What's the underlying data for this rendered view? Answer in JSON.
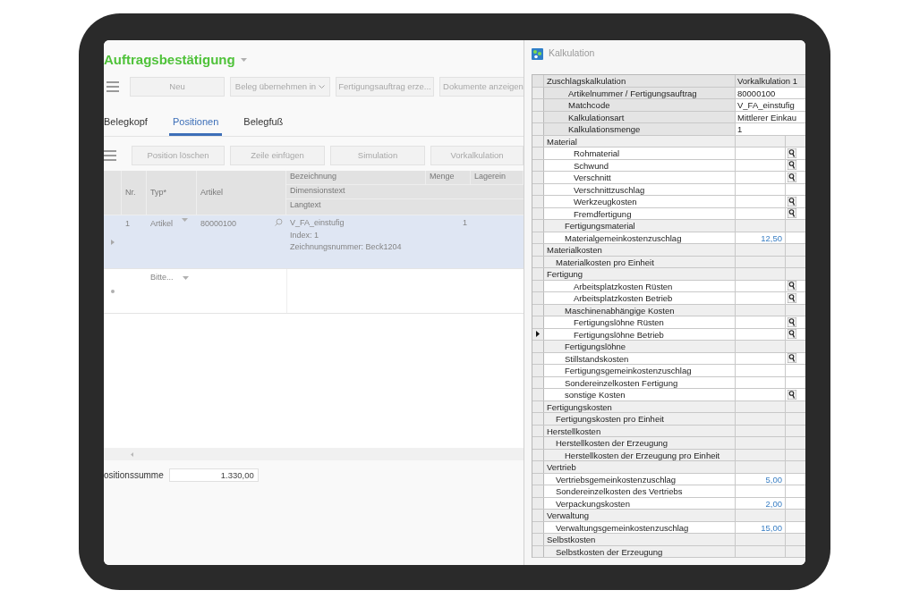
{
  "order": {
    "title": "Auftragsbestätigung",
    "toolbar": [
      {
        "label": "Neu",
        "kind": "button"
      },
      {
        "label": "Beleg übernehmen in",
        "kind": "dropdown"
      },
      {
        "label": "Fertigungsauftrag erze...",
        "kind": "button"
      },
      {
        "label": "Dokumente anzeigen",
        "kind": "button"
      }
    ],
    "tabs": [
      {
        "label": "Belegkopf",
        "selected": false
      },
      {
        "label": "Positionen",
        "selected": true
      },
      {
        "label": "Belegfuß",
        "selected": false
      }
    ],
    "grid_toolbar": [
      "Position löschen",
      "Zeile einfügen",
      "Simulation",
      "Vorkalkulation"
    ],
    "grid": {
      "columns": [
        "Nr.",
        "Typ*",
        "Artikel"
      ],
      "upper_columns": [
        "Bezeichnung",
        "Menge",
        "Lagerein"
      ],
      "dimension_column": "Dimensionstext",
      "longtext_column": "Langtext",
      "rows": [
        {
          "nr": "1",
          "type": "Artikel",
          "article": "80000100",
          "name": "V_FA_einstufig",
          "quantity": "1",
          "details": [
            "Index: 1",
            "Zeichnungsnummer: Beck1204"
          ],
          "selected": true
        }
      ],
      "new_row": {
        "type_placeholder": "Bitte..."
      }
    },
    "footer": {
      "label": "ositionssumme",
      "value": "1.330,00"
    }
  },
  "kalkulation": {
    "title": "Kalkulation",
    "header": [
      "Zuschlagskalkulation",
      "Vorkalkulation 1"
    ],
    "info": [
      {
        "label": "Artikelnummer / Fertigungsauftrag",
        "value": "80000100"
      },
      {
        "label": "Matchcode",
        "value": "V_FA_einstufig"
      },
      {
        "label": "Kalkulationsart",
        "value": "Mittlerer Einkau"
      },
      {
        "label": "Kalkulationsmenge",
        "value": "1"
      }
    ],
    "tree": [
      {
        "label": "Material",
        "kind": "section",
        "current": false,
        "children": [
          {
            "label": "Fertigungsmaterial",
            "kind": "subtotal",
            "current": false,
            "children": [
              {
                "label": "Rohmaterial",
                "kind": "cost",
                "current": false
              },
              {
                "label": "Schwund",
                "kind": "cost",
                "current": false
              },
              {
                "label": "Verschnitt",
                "kind": "cost",
                "current": false
              },
              {
                "label": "Verschnittzuschlag",
                "kind": "entry",
                "current": false
              },
              {
                "label": "Werkzeugkosten",
                "kind": "cost",
                "current": false
              },
              {
                "label": "Fremdfertigung",
                "kind": "cost",
                "current": false
              }
            ]
          },
          {
            "label": "Materialgemeinkostenzuschlag",
            "kind": "entry",
            "value": "12,50",
            "current": false
          }
        ]
      },
      {
        "label": "Materialkosten",
        "kind": "section",
        "current": false,
        "children": [
          {
            "label": "Materialkosten pro Einheit",
            "kind": "total",
            "current": false
          }
        ]
      },
      {
        "label": "Fertigung",
        "kind": "section",
        "current": false,
        "children": [
          {
            "label": "Maschinenabhängige Kosten",
            "kind": "subtotal",
            "current": false,
            "children": [
              {
                "label": "Arbeitsplatzkosten Rüsten",
                "kind": "cost",
                "current": false
              },
              {
                "label": "Arbeitsplatzkosten Betrieb",
                "kind": "cost",
                "current": false
              }
            ]
          },
          {
            "label": "Fertigungslöhne",
            "kind": "subtotal",
            "current": false,
            "children": [
              {
                "label": "Fertigungslöhne Rüsten",
                "kind": "cost",
                "current": false
              },
              {
                "label": "Fertigungslöhne Betrieb",
                "kind": "cost",
                "current": true
              }
            ]
          },
          {
            "label": "Stillstandskosten",
            "kind": "cost",
            "current": false
          },
          {
            "label": "Fertigungsgemeinkostenzuschlag",
            "kind": "entry",
            "current": false
          },
          {
            "label": "Sondereinzelkosten Fertigung",
            "kind": "entry",
            "current": false
          },
          {
            "label": "sonstige Kosten",
            "kind": "cost",
            "current": false
          }
        ]
      },
      {
        "label": "Fertigungskosten",
        "kind": "section",
        "current": false,
        "children": [
          {
            "label": "Fertigungskosten pro Einheit",
            "kind": "total",
            "current": false
          }
        ]
      },
      {
        "label": "Herstellkosten",
        "kind": "section",
        "current": false,
        "children": [
          {
            "label": "Herstellkosten der Erzeugung",
            "kind": "total",
            "current": false,
            "children": [
              {
                "label": "Herstellkosten der Erzeugung pro Einheit",
                "kind": "total",
                "current": false
              }
            ]
          }
        ]
      },
      {
        "label": "Vertrieb",
        "kind": "section",
        "current": false,
        "children": [
          {
            "label": "Vertriebsgemeinkostenzuschlag",
            "kind": "rate",
            "value": "5,00",
            "current": false
          },
          {
            "label": "Sondereinzelkosten des Vertriebs",
            "kind": "rate",
            "current": false
          },
          {
            "label": "Verpackungskosten",
            "kind": "rate",
            "value": "2,00",
            "current": false
          }
        ]
      },
      {
        "label": "Verwaltung",
        "kind": "section",
        "current": false,
        "children": [
          {
            "label": "Verwaltungsgemeinkostenzuschlag",
            "kind": "rate",
            "value": "15,00",
            "current": false
          }
        ]
      },
      {
        "label": "Selbstkosten",
        "kind": "section",
        "current": false,
        "children": [
          {
            "label": "Selbstkosten der Erzeugung",
            "kind": "total",
            "current": false
          }
        ]
      }
    ]
  }
}
